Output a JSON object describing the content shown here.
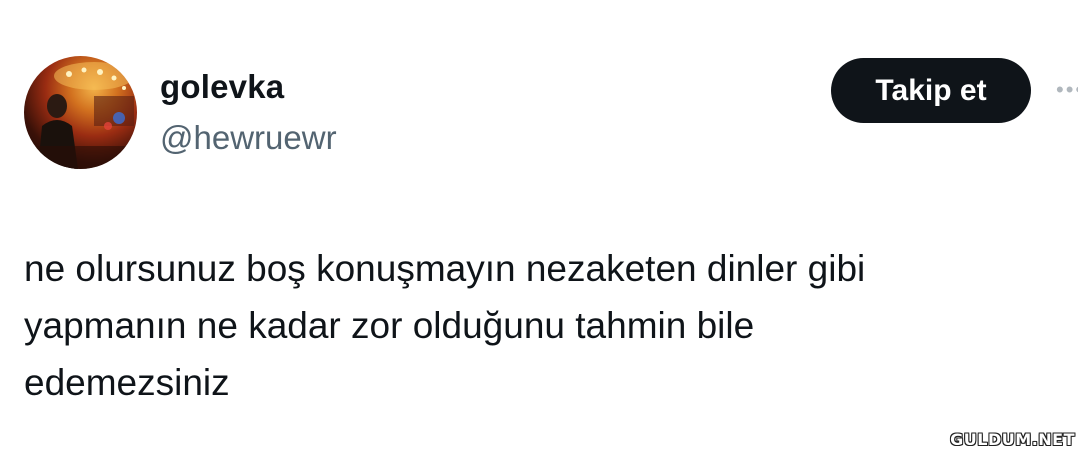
{
  "tweet": {
    "author": {
      "display_name": "golevka",
      "handle": "@hewruewr",
      "avatar_icon": "profile-photo"
    },
    "follow_button_label": "Takip et",
    "more_icon": "more-options-icon",
    "text_lines": [
      "ne olursunuz boş konuşmayın nezaketen dinler gibi",
      "yapmanın ne kadar zor olduğunu tahmin bile",
      "edemezsiniz"
    ]
  },
  "watermark": "GULDUM.NET",
  "colors": {
    "primary_text": "#0f1419",
    "secondary_text": "#536471",
    "button_bg": "#0f1419",
    "button_text": "#ffffff"
  }
}
